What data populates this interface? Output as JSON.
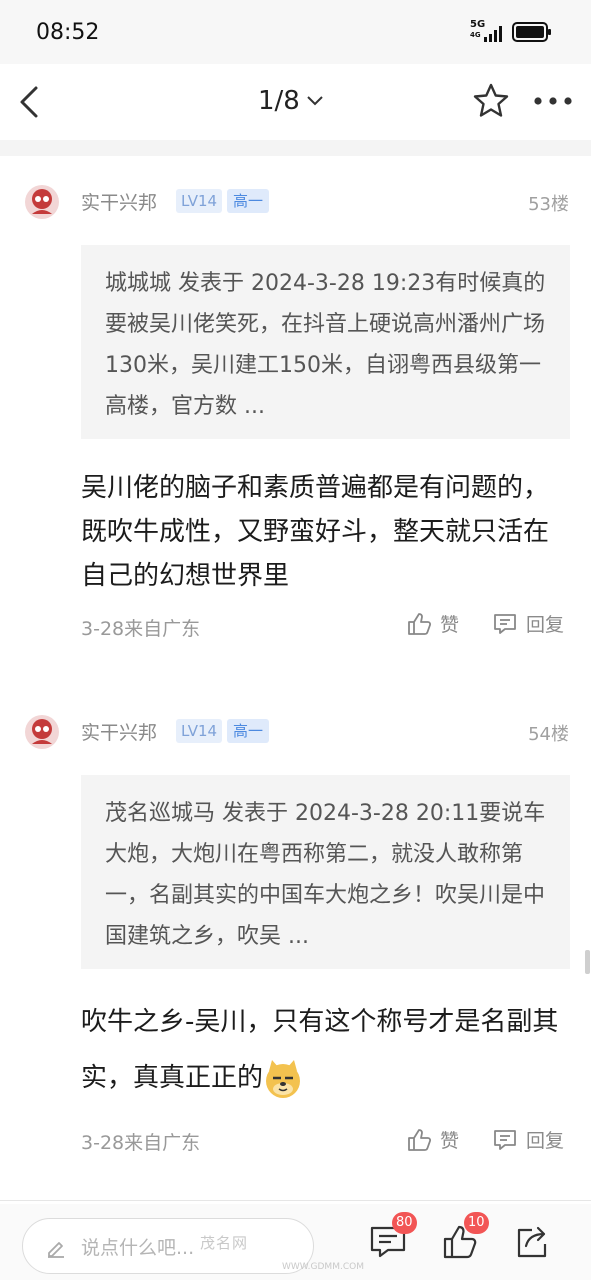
{
  "status_bar": {
    "time": "08:52",
    "network": "5G",
    "network_sub": "4G"
  },
  "nav": {
    "page_indicator": "1/8"
  },
  "posts": [
    {
      "username": "实干兴邦",
      "level": "LV14",
      "grade": "高一",
      "floor": "53楼",
      "quote": "城城城 发表于 2024-3-28 19:23有时候真的要被吴川佬笑死，在抖音上硬说高州潘州广场130米，吴川建工150米，自诩粤西县级第一高楼，官方数 ...",
      "content": "吴川佬的脑子和素质普遍都是有问题的，既吹牛成性，又野蛮好斗，整天就只活在自己的幻想世界里",
      "time_location": "3-28来自广东",
      "like_label": "赞",
      "reply_label": "回复"
    },
    {
      "username": "实干兴邦",
      "level": "LV14",
      "grade": "高一",
      "floor": "54楼",
      "quote": "茂名巡城马 发表于 2024-3-28 20:11要说车大炮，大炮川在粤西称第二，就没人敢称第一，名副其实的中国车大炮之乡！吹吴川是中国建筑之乡，吹吴 ...",
      "content": "吹牛之乡-吴川，只有这个称号才是名副其实，真真正正的",
      "time_location": "3-28来自广东",
      "like_label": "赞",
      "reply_label": "回复"
    }
  ],
  "bottom_bar": {
    "input_placeholder": "说点什么吧...",
    "comment_count": "80",
    "like_count": "10"
  },
  "watermark": {
    "text": "茂名网",
    "url": "WWW.GDMM.COM"
  },
  "colors": {
    "accent_badge": "#4d8ae0",
    "count_badge": "#f25555"
  }
}
